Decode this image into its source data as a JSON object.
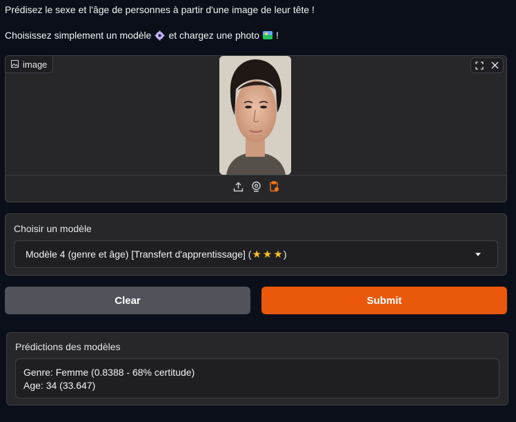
{
  "intro": {
    "line1": "Prédisez le sexe et l'âge de personnes à partir d'une image de leur tête !",
    "line2_before": "Choisissez simplement un modèle",
    "line2_middle": "et chargez une photo",
    "line2_end": "!"
  },
  "image_input": {
    "label": "image",
    "icons": [
      "image-icon",
      "fullscreen-icon",
      "close-icon",
      "upload-icon",
      "webcam-icon",
      "clipboard-icon"
    ]
  },
  "model": {
    "label": "Choisir un modèle",
    "selected_text": "Modèle 4 (genre et âge) [Transfert d'apprentissage] (",
    "selected_end": ")",
    "stars": [
      "star-icon",
      "star-icon",
      "star-icon"
    ]
  },
  "buttons": {
    "clear": "Clear",
    "submit": "Submit"
  },
  "predictions": {
    "label": "Prédictions des modèles",
    "text": "Genre: Femme (0.8388 - 68% certitude)\nAge: 34 (33.647)"
  },
  "colors": {
    "page_bg": "#0b0f19",
    "panel_bg": "#27272a",
    "accent": "#ea580c",
    "secondary": "#52525b"
  }
}
